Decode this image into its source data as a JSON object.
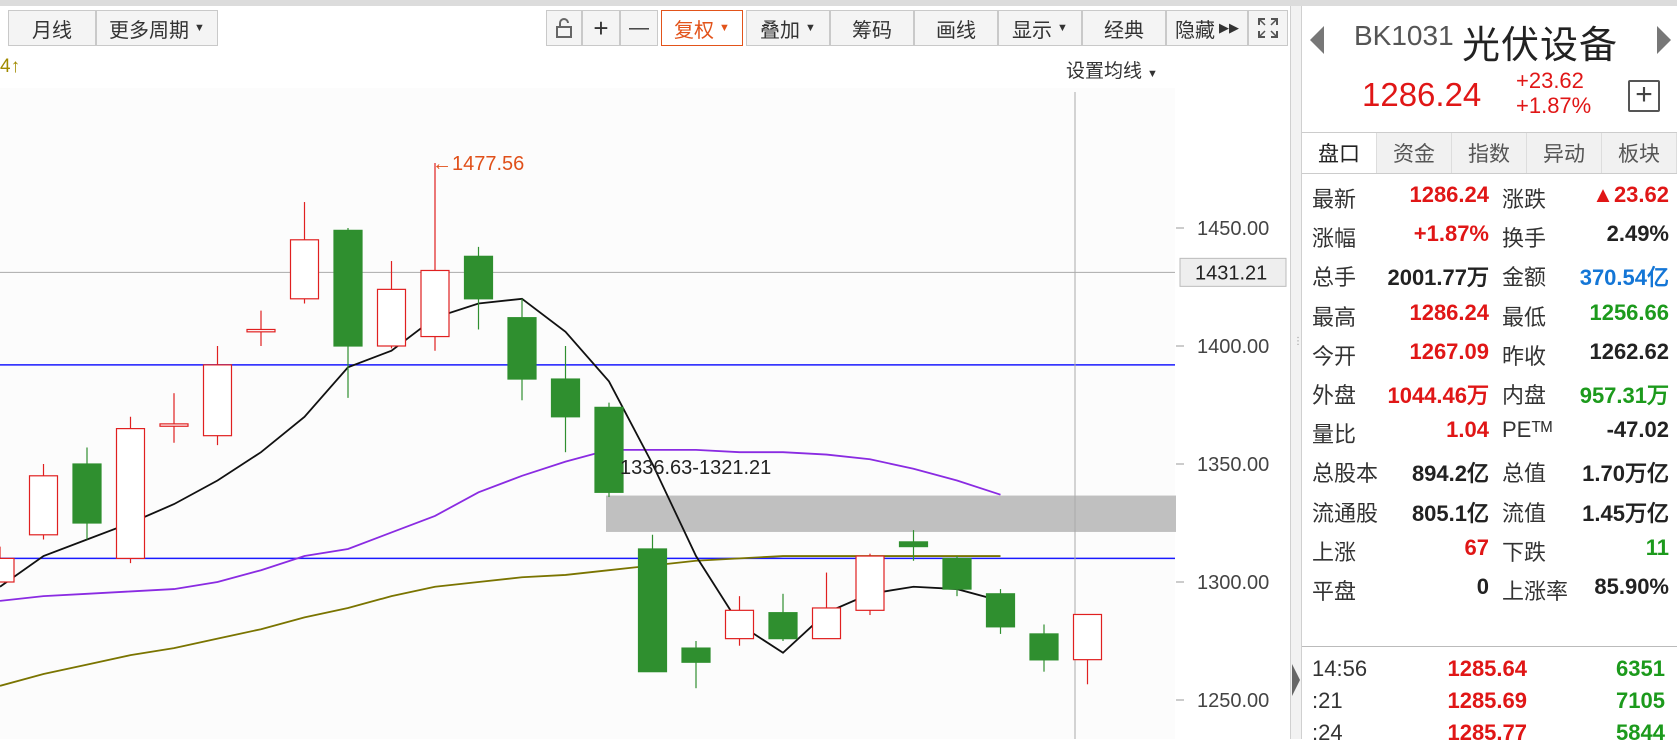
{
  "toolbar": {
    "buttons": [
      "月线",
      "更多周期",
      "复权",
      "叠加",
      "筹码",
      "画线",
      "显示",
      "经典",
      "隐藏"
    ],
    "zoom_in": "+",
    "zoom_out": "—"
  },
  "chart": {
    "ma_settings_label": "设置均线",
    "ma_info": "4↑",
    "annotation_high": "←1477.56",
    "gap_label": "1336.63-1321.21",
    "price_tag": "1431.21",
    "y_ticks": [
      "1450.00",
      "1400.00",
      "1350.00",
      "1300.00",
      "1250.00"
    ]
  },
  "chart_data": {
    "type": "candlestick",
    "y_axis_ticks": [
      1250,
      1300,
      1350,
      1400,
      1450
    ],
    "horizontal_lines": [
      1431.21,
      1392,
      1310
    ],
    "gap_range": [
      1321.21,
      1336.63
    ],
    "max_marker": 1477.56,
    "candles": [
      {
        "o": 1300,
        "c": 1310,
        "h": 1315,
        "l": 1305
      },
      {
        "o": 1320,
        "c": 1345,
        "h": 1350,
        "l": 1318
      },
      {
        "o": 1350,
        "c": 1325,
        "h": 1357,
        "l": 1318
      },
      {
        "o": 1310,
        "c": 1365,
        "h": 1370,
        "l": 1308
      },
      {
        "o": 1366,
        "c": 1367,
        "h": 1380,
        "l": 1359
      },
      {
        "o": 1362,
        "c": 1392,
        "h": 1400,
        "l": 1358
      },
      {
        "o": 1406,
        "c": 1407,
        "h": 1415,
        "l": 1400
      },
      {
        "o": 1420,
        "c": 1445,
        "h": 1461,
        "l": 1418
      },
      {
        "o": 1449,
        "c": 1400,
        "h": 1450,
        "l": 1378
      },
      {
        "o": 1400,
        "c": 1424,
        "h": 1436,
        "l": 1399
      },
      {
        "o": 1404,
        "c": 1432,
        "h": 1477.56,
        "l": 1398
      },
      {
        "o": 1438,
        "c": 1420,
        "h": 1442,
        "l": 1407
      },
      {
        "o": 1412,
        "c": 1386,
        "h": 1420,
        "l": 1377
      },
      {
        "o": 1386,
        "c": 1370,
        "h": 1400,
        "l": 1355
      },
      {
        "o": 1374,
        "c": 1338,
        "h": 1376,
        "l": 1336
      },
      {
        "o": 1314,
        "c": 1262,
        "h": 1320,
        "l": 1262
      },
      {
        "o": 1272,
        "c": 1266,
        "h": 1275,
        "l": 1255
      },
      {
        "o": 1276,
        "c": 1288,
        "h": 1294,
        "l": 1273
      },
      {
        "o": 1287,
        "c": 1276,
        "h": 1295,
        "l": 1275
      },
      {
        "o": 1276,
        "c": 1289,
        "h": 1304,
        "l": 1276
      },
      {
        "o": 1288,
        "c": 1311,
        "h": 1312,
        "l": 1286
      },
      {
        "o": 1317,
        "c": 1315,
        "h": 1322,
        "l": 1309
      },
      {
        "o": 1310,
        "c": 1297,
        "h": 1311,
        "l": 1294
      },
      {
        "o": 1295,
        "c": 1281,
        "h": 1297,
        "l": 1278
      },
      {
        "o": 1278,
        "c": 1267,
        "h": 1282,
        "l": 1262
      },
      {
        "o": 1267.09,
        "c": 1286.24,
        "h": 1286.24,
        "l": 1256.66
      }
    ],
    "ma_black": [
      1298,
      1311,
      1318,
      1325,
      1333,
      1343,
      1355,
      1370,
      1391,
      1398,
      1412,
      1418,
      1420,
      1406,
      1385,
      1350,
      1311,
      1282,
      1270,
      1287,
      1295,
      1298,
      1297,
      1292
    ],
    "ma_purple": [
      1292,
      1294,
      1295,
      1296,
      1297,
      1300,
      1305,
      1311,
      1314,
      1321,
      1328,
      1338,
      1345,
      1351,
      1356,
      1356,
      1356,
      1355,
      1355,
      1354,
      1352,
      1348,
      1343,
      1337
    ],
    "ma_olive": [
      1256,
      1261,
      1265,
      1269,
      1272,
      1276,
      1280,
      1285,
      1289,
      1294,
      1298,
      1300,
      1302,
      1303,
      1305,
      1307,
      1309,
      1310,
      1311,
      1311,
      1311,
      1311,
      1311,
      1311
    ]
  },
  "panel": {
    "code": "BK1031",
    "name": "光伏设备",
    "price": "1286.24",
    "change": "+23.62",
    "change_pct": "+1.87%",
    "add_label": "+",
    "tabs": [
      "盘口",
      "资金",
      "指数",
      "异动",
      "板块"
    ],
    "quote": [
      {
        "l1": "最新",
        "v1": "1286.24",
        "c1": "red",
        "l2": "涨跌",
        "v2": "▲23.62",
        "c2": "red"
      },
      {
        "l1": "涨幅",
        "v1": "+1.87%",
        "c1": "red",
        "l2": "换手",
        "v2": "2.49%",
        "c2": "dark"
      },
      {
        "l1": "总手",
        "v1": "2001.77万",
        "c1": "dark",
        "l2": "金额",
        "v2": "370.54亿",
        "c2": "blue"
      },
      {
        "l1": "最高",
        "v1": "1286.24",
        "c1": "red",
        "l2": "最低",
        "v2": "1256.66",
        "c2": "green"
      },
      {
        "l1": "今开",
        "v1": "1267.09",
        "c1": "red",
        "l2": "昨收",
        "v2": "1262.62",
        "c2": "dark"
      },
      {
        "l1": "外盘",
        "v1": "1044.46万",
        "c1": "red",
        "l2": "内盘",
        "v2": "957.31万",
        "c2": "green"
      },
      {
        "l1": "量比",
        "v1": "1.04",
        "c1": "red",
        "l2": "PEᵀᴹ",
        "v2": "-47.02",
        "c2": "dark"
      },
      {
        "l1": "总股本",
        "v1": "894.2亿",
        "c1": "dark",
        "l2": "总值",
        "v2": "1.70万亿",
        "c2": "dark"
      },
      {
        "l1": "流通股",
        "v1": "805.1亿",
        "c1": "dark",
        "l2": "流值",
        "v2": "1.45万亿",
        "c2": "dark"
      },
      {
        "l1": "上涨",
        "v1": "67",
        "c1": "red",
        "l2": "下跌",
        "v2": "11",
        "c2": "green"
      },
      {
        "l1": "平盘",
        "v1": "0",
        "c1": "dark",
        "l2": "上涨率",
        "v2": "85.90%",
        "c2": "dark"
      }
    ],
    "trades": [
      {
        "time": "14:56",
        "price": "1285.64",
        "vol": "6351"
      },
      {
        "time": ":21",
        "price": "1285.69",
        "vol": "7105"
      },
      {
        "time": ":24",
        "price": "1285.77",
        "vol": "5844"
      }
    ]
  }
}
